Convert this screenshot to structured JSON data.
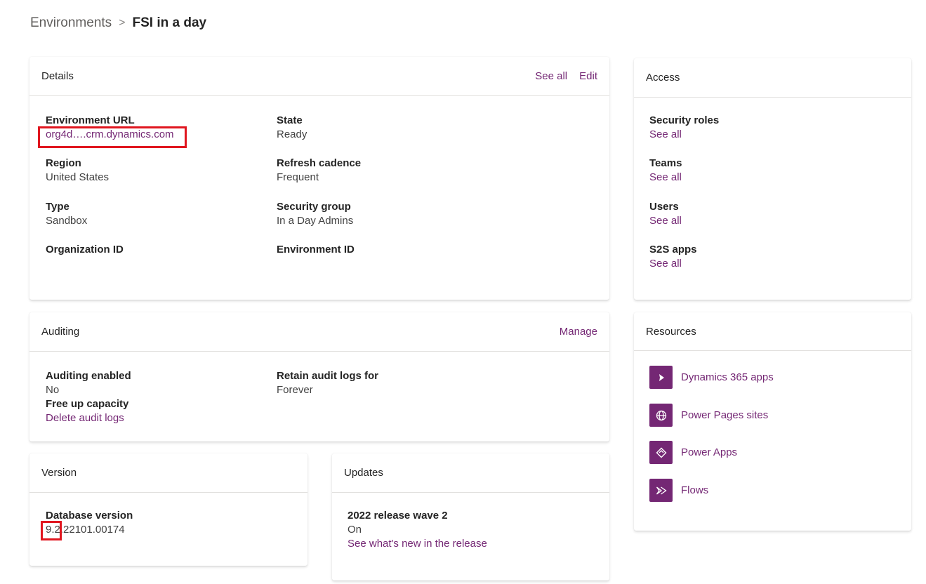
{
  "breadcrumb": {
    "parent": "Environments",
    "separator": ">",
    "current": "FSI in a day"
  },
  "details": {
    "title": "Details",
    "see_all": "See all",
    "edit": "Edit",
    "environment_url": {
      "label": "Environment URL",
      "value": "org4d….crm.dynamics.com"
    },
    "state": {
      "label": "State",
      "value": "Ready"
    },
    "region": {
      "label": "Region",
      "value": "United States"
    },
    "refresh_cadence": {
      "label": "Refresh cadence",
      "value": "Frequent"
    },
    "type": {
      "label": "Type",
      "value": "Sandbox"
    },
    "security_group": {
      "label": "Security group",
      "value": "In a Day Admins"
    },
    "organization_id": {
      "label": "Organization ID"
    },
    "environment_id": {
      "label": "Environment ID"
    }
  },
  "access": {
    "title": "Access",
    "security_roles": {
      "label": "Security roles",
      "link": "See all"
    },
    "teams": {
      "label": "Teams",
      "link": "See all"
    },
    "users": {
      "label": "Users",
      "link": "See all"
    },
    "s2s_apps": {
      "label": "S2S apps",
      "link": "See all"
    }
  },
  "auditing": {
    "title": "Auditing",
    "manage": "Manage",
    "auditing_enabled": {
      "label": "Auditing enabled",
      "value": "No"
    },
    "retain_logs": {
      "label": "Retain audit logs for",
      "value": "Forever"
    },
    "free_up_capacity": {
      "label": "Free up capacity",
      "link": "Delete audit logs"
    }
  },
  "resources": {
    "title": "Resources",
    "items": [
      {
        "label": "Dynamics 365 apps",
        "icon": "dynamics-365-icon"
      },
      {
        "label": "Power Pages sites",
        "icon": "globe-icon"
      },
      {
        "label": "Power Apps",
        "icon": "power-apps-icon"
      },
      {
        "label": "Flows",
        "icon": "flows-icon"
      }
    ]
  },
  "version": {
    "title": "Version",
    "database_version": {
      "label": "Database version",
      "value": "9.2.22101.00174"
    }
  },
  "updates": {
    "title": "Updates",
    "release": {
      "label": "2022 release wave 2",
      "value": "On",
      "link": "See what's new in the release"
    }
  },
  "colors": {
    "accent": "#742774",
    "highlight": "#e0161f"
  }
}
